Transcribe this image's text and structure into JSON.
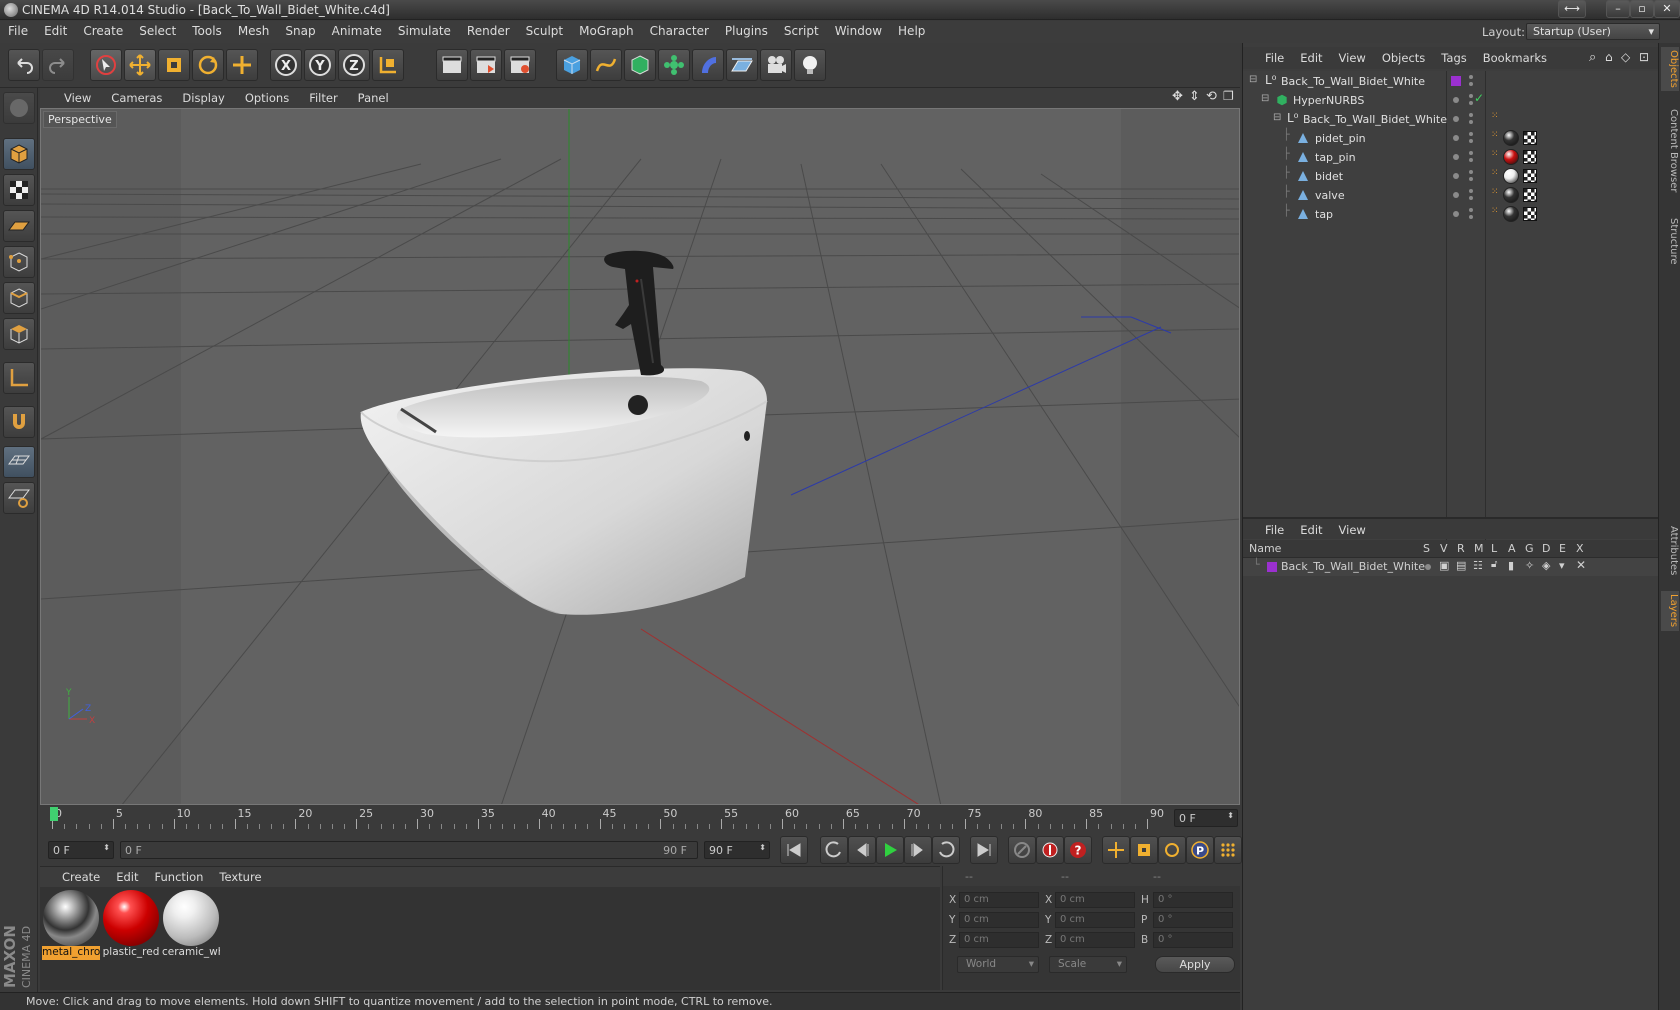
{
  "app": {
    "title": "CINEMA 4D R14.014 Studio - [Back_To_Wall_Bidet_White.c4d]"
  },
  "menu": [
    "File",
    "Edit",
    "Create",
    "Select",
    "Tools",
    "Mesh",
    "Snap",
    "Animate",
    "Simulate",
    "Render",
    "Sculpt",
    "MoGraph",
    "Character",
    "Plugins",
    "Script",
    "Window",
    "Help"
  ],
  "layout": {
    "label": "Layout:",
    "value": "Startup (User)"
  },
  "viewport": {
    "menu": [
      "View",
      "Cameras",
      "Display",
      "Options",
      "Filter",
      "Panel"
    ],
    "label": "Perspective",
    "axis": {
      "x": "X",
      "y": "Y",
      "z": "Z"
    }
  },
  "timeline": {
    "ticks": [
      "0",
      "5",
      "10",
      "15",
      "20",
      "25",
      "30",
      "35",
      "40",
      "45",
      "50",
      "55",
      "60",
      "65",
      "70",
      "75",
      "80",
      "85",
      "90"
    ],
    "frame_field": "0 F"
  },
  "playbar": {
    "start": "0 F",
    "range_start": "0 F",
    "range_end": "90 F",
    "end": "90 F"
  },
  "materials": {
    "menu": [
      "Create",
      "Edit",
      "Function",
      "Texture"
    ],
    "items": [
      {
        "label": "metal_chro",
        "selected": true
      },
      {
        "label": "plastic_red",
        "selected": false
      },
      {
        "label": "ceramic_wh",
        "selected": false
      }
    ]
  },
  "coords": {
    "headers": [
      "--",
      "--",
      "--"
    ],
    "rows": [
      {
        "a": "X",
        "av": "0 cm",
        "b": "X",
        "bv": "0 cm",
        "c": "H",
        "cv": "0 °"
      },
      {
        "a": "Y",
        "av": "0 cm",
        "b": "Y",
        "bv": "0 cm",
        "c": "P",
        "cv": "0 °"
      },
      {
        "a": "Z",
        "av": "0 cm",
        "b": "Z",
        "bv": "0 cm",
        "c": "B",
        "cv": "0 °"
      }
    ],
    "world": "World",
    "scale": "Scale",
    "apply": "Apply"
  },
  "status": "Move: Click and drag to move elements. Hold down SHIFT to quantize movement / add to the selection in point mode, CTRL to remove.",
  "objects": {
    "menu": [
      "File",
      "Edit",
      "View",
      "Objects",
      "Tags",
      "Bookmarks"
    ],
    "items": [
      {
        "name": "Back_To_Wall_Bidet_White",
        "icon": "null-icon"
      },
      {
        "name": "HyperNURBS",
        "icon": "hypernurbs-icon"
      },
      {
        "name": "Back_To_Wall_Bidet_White",
        "icon": "null-icon"
      },
      {
        "name": "pidet_pin",
        "icon": "polygon-icon"
      },
      {
        "name": "tap_pin",
        "icon": "polygon-icon"
      },
      {
        "name": "bidet",
        "icon": "polygon-icon"
      },
      {
        "name": "valve",
        "icon": "polygon-icon"
      },
      {
        "name": "tap",
        "icon": "polygon-icon"
      }
    ]
  },
  "layers": {
    "menu": [
      "File",
      "Edit",
      "View"
    ],
    "columns": [
      "Name",
      "S",
      "V",
      "R",
      "M",
      "L",
      "A",
      "G",
      "D",
      "E",
      "X"
    ],
    "row": "Back_To_Wall_Bidet_White"
  },
  "sidetabs": [
    "Objects",
    "Content Browser",
    "Structure",
    "Attributes",
    "Layers"
  ],
  "brand": {
    "maxon": "MAXON",
    "c4d": "CINEMA 4D"
  },
  "colors": {
    "accent_orange": "#f0a030",
    "layer_purple": "#9b30d0",
    "axis_x": "#c03030",
    "axis_y": "#30a030",
    "axis_z": "#3040c0"
  }
}
